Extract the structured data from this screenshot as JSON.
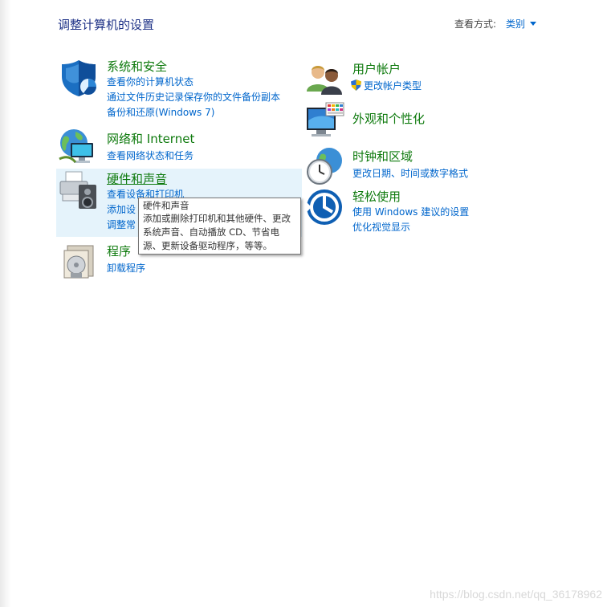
{
  "header": {
    "title": "调整计算机的设置",
    "view_by_label": "查看方式:",
    "view_by_value": "类别"
  },
  "categories": {
    "system_security": {
      "title": "系统和安全",
      "links": [
        "查看你的计算机状态",
        "通过文件历史记录保存你的文件备份副本",
        "备份和还原(Windows 7)"
      ]
    },
    "network": {
      "title": "网络和 Internet",
      "links": [
        "查看网络状态和任务"
      ]
    },
    "hardware": {
      "title": "硬件和声音",
      "links": [
        "查看设备和打印机",
        "添加设",
        "调整常"
      ]
    },
    "programs": {
      "title": "程序",
      "links": [
        "卸载程序"
      ]
    },
    "user_accounts": {
      "title": "用户帐户",
      "links": [
        "更改帐户类型"
      ]
    },
    "appearance": {
      "title": "外观和个性化",
      "links": []
    },
    "clock_region": {
      "title": "时钟和区域",
      "links": [
        "更改日期、时间或数字格式"
      ]
    },
    "ease_access": {
      "title": "轻松使用",
      "links": [
        "使用 Windows 建议的设置",
        "优化视觉显示"
      ]
    }
  },
  "tooltip": {
    "title": "硬件和声音",
    "lines": [
      "添加或删除打印机和其他硬件、更改",
      "系统声音、自动播放 CD、节省电",
      "源、更新设备驱动程序，等等。"
    ]
  },
  "watermark": "https://blog.csdn.net/qq_36178962",
  "colors": {
    "title_blue": "#1e3287",
    "category_green": "#0e7a0d",
    "link_blue": "#0066cc",
    "hover_bg": "#e5f3fb"
  }
}
